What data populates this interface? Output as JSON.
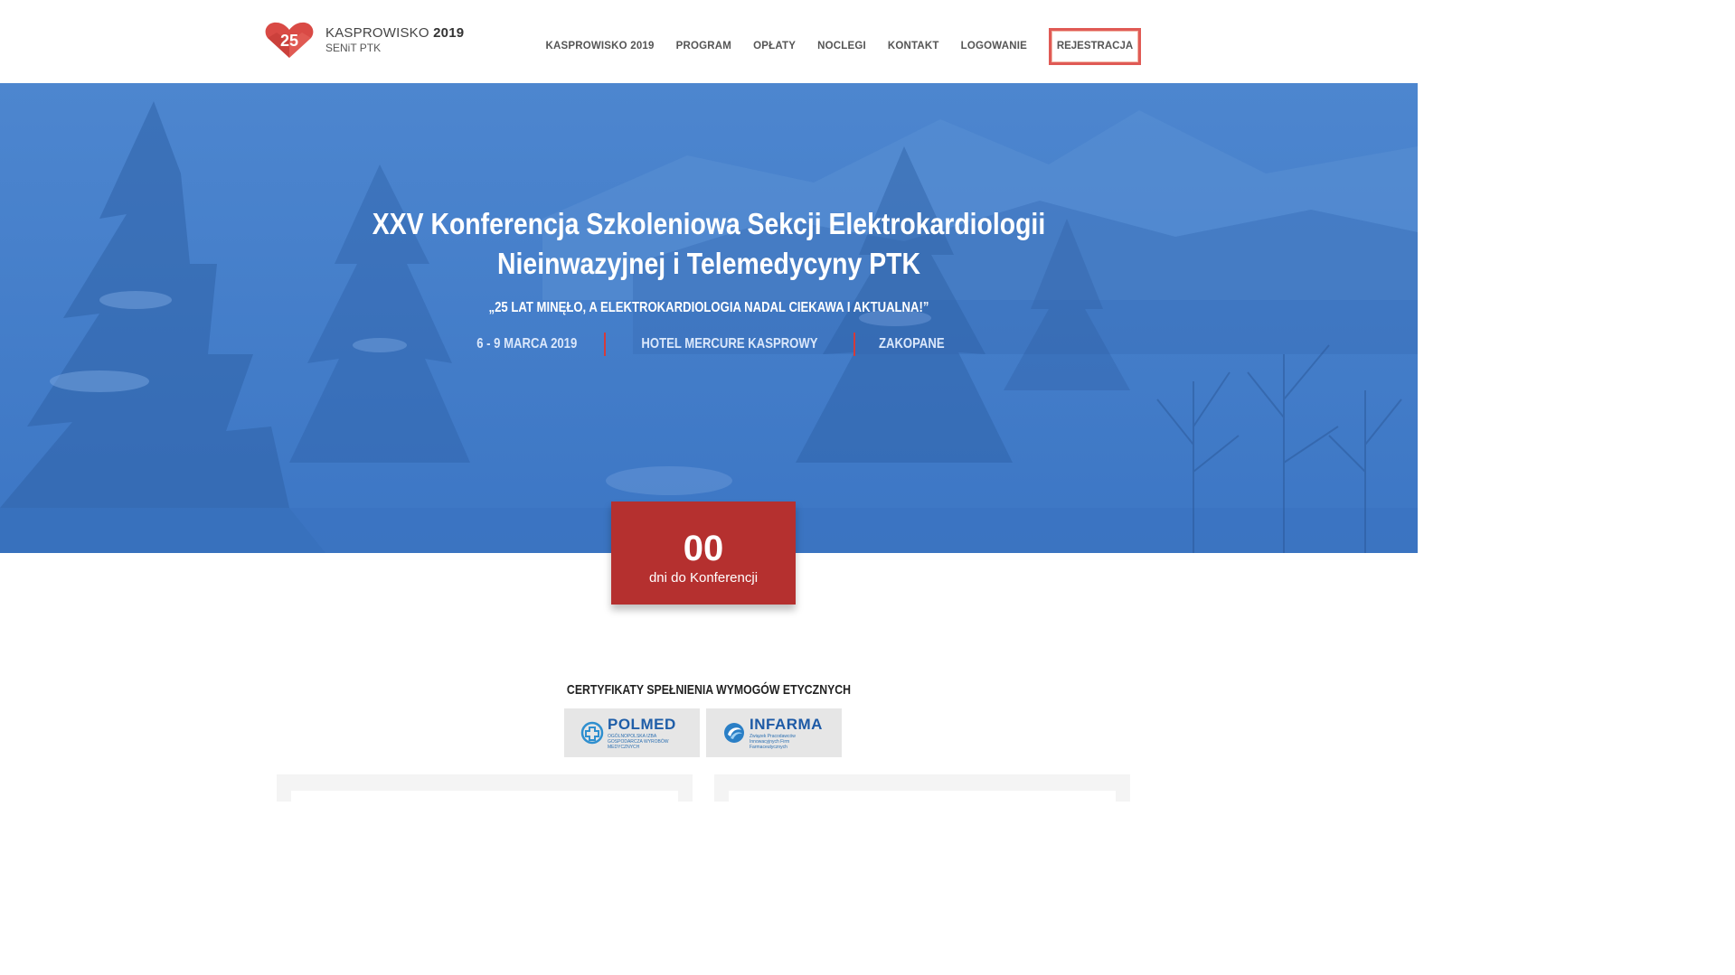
{
  "brand": {
    "logo_number": "25",
    "name": "KASPROWISKO",
    "year": "2019",
    "org": "SENiT PTK",
    "colors": {
      "red": "#d94a45",
      "blue": "#3f7ac7",
      "dark_red": "#b5302f"
    }
  },
  "nav": {
    "items": [
      "KASPROWISKO 2019",
      "PROGRAM",
      "OPŁATY",
      "NOCLEGI",
      "KONTAKT",
      "LOGOWANIE"
    ],
    "register_label": "REJESTRACJA"
  },
  "hero": {
    "title_line1": "XXV Konferencja Szkoleniowa Sekcji Elektrokardiologii",
    "title_line2": "Nieinwazyjnej i Telemedycyny PTK",
    "subtitle": "„25 LAT MINĘŁO, A ELEKTROKARDIOLOGIA NADAL CIEKAWA I AKTUALNA!”",
    "dates": "6 - 9 MARCA 2019",
    "venue": "HOTEL MERCURE KASPROWY",
    "city": "ZAKOPANE"
  },
  "countdown": {
    "value": "00",
    "label": "dni do Konferencji"
  },
  "certificates": {
    "title": "CERTYFIKATY SPEŁNIENIA WYMOGÓW ETYCZNYCH",
    "logos": [
      {
        "name": "POLMED",
        "tagline": "OGÓLNOPOLSKA IZBA GOSPODARCZA WYROBÓW MEDYCZNYCH",
        "icon": "polmed-cross-icon"
      },
      {
        "name": "INFARMA",
        "tagline": "Związek Pracodawców Innowacyjnych Firm Farmaceutycznych",
        "icon": "infarma-swirl-icon"
      }
    ]
  }
}
